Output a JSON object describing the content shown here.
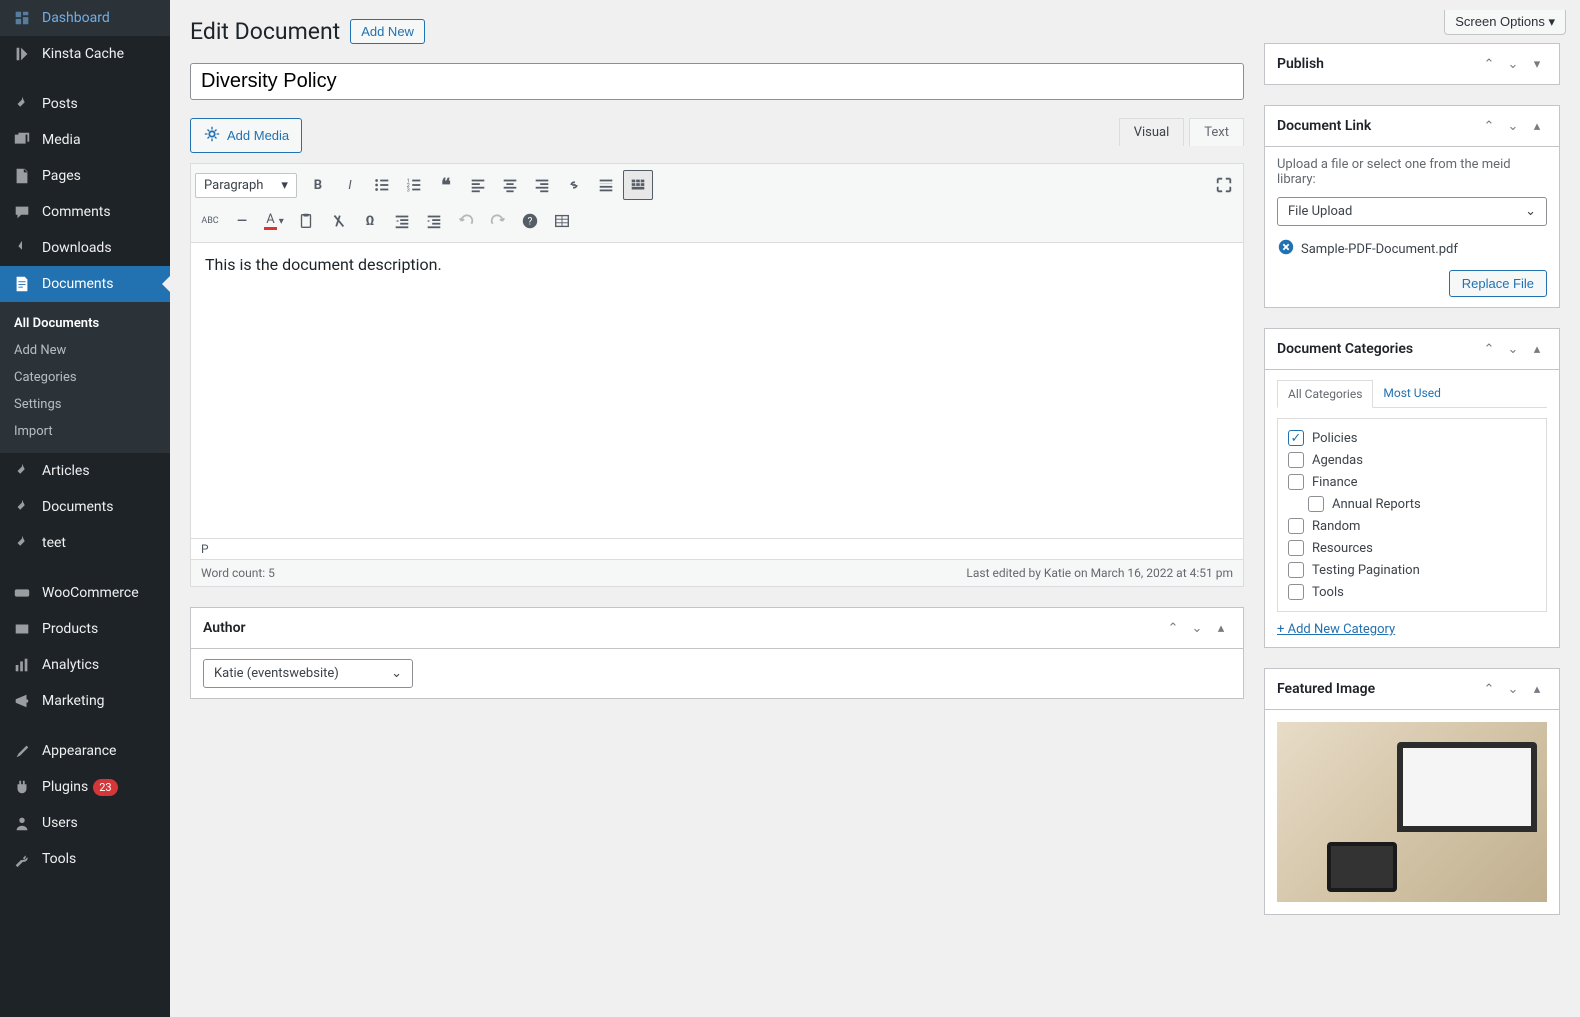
{
  "sidebar": {
    "items": [
      {
        "icon": "dashboard",
        "label": "Dashboard"
      },
      {
        "icon": "kinsta",
        "label": "Kinsta Cache"
      },
      {
        "icon": "pin",
        "label": "Posts"
      },
      {
        "icon": "media",
        "label": "Media"
      },
      {
        "icon": "page",
        "label": "Pages"
      },
      {
        "icon": "comment",
        "label": "Comments"
      },
      {
        "icon": "download",
        "label": "Downloads"
      },
      {
        "icon": "document",
        "label": "Documents",
        "active": true
      },
      {
        "icon": "pin",
        "label": "Articles"
      },
      {
        "icon": "pin",
        "label": "Documents"
      },
      {
        "icon": "pin",
        "label": "teet"
      },
      {
        "icon": "woo",
        "label": "WooCommerce"
      },
      {
        "icon": "product",
        "label": "Products"
      },
      {
        "icon": "analytics",
        "label": "Analytics"
      },
      {
        "icon": "marketing",
        "label": "Marketing"
      },
      {
        "icon": "appearance",
        "label": "Appearance"
      },
      {
        "icon": "plugin",
        "label": "Plugins",
        "badge": "23"
      },
      {
        "icon": "user",
        "label": "Users"
      },
      {
        "icon": "tools",
        "label": "Tools"
      }
    ],
    "submenu": [
      {
        "label": "All Documents",
        "current": true
      },
      {
        "label": "Add New"
      },
      {
        "label": "Categories"
      },
      {
        "label": "Settings"
      },
      {
        "label": "Import"
      }
    ]
  },
  "screenOptions": "Screen Options",
  "header": {
    "title": "Edit Document",
    "addNew": "Add New"
  },
  "titleInput": "Diversity Policy",
  "addMedia": "Add Media",
  "editorTabs": {
    "visual": "Visual",
    "text": "Text"
  },
  "formatSelect": "Paragraph",
  "editorContent": "This is the document description.",
  "editorPath": "P",
  "wordCount": "Word count: 5",
  "lastEdited": "Last edited by Katie on March 16, 2022 at 4:51 pm",
  "authorBox": {
    "title": "Author",
    "value": "Katie (eventswebsite)"
  },
  "publishBox": {
    "title": "Publish"
  },
  "docLinkBox": {
    "title": "Document Link",
    "help": "Upload a file or select one from the meid library:",
    "select": "File Upload",
    "file": "Sample-PDF-Document.pdf",
    "replace": "Replace File"
  },
  "catBox": {
    "title": "Document Categories",
    "tabAll": "All Categories",
    "tabMost": "Most Used",
    "items": [
      {
        "label": "Policies",
        "checked": true
      },
      {
        "label": "Agendas"
      },
      {
        "label": "Finance"
      },
      {
        "label": "Annual Reports",
        "indent": true
      },
      {
        "label": "Random"
      },
      {
        "label": "Resources"
      },
      {
        "label": "Testing Pagination"
      },
      {
        "label": "Tools"
      }
    ],
    "addNew": "+ Add New Category"
  },
  "featuredBox": {
    "title": "Featured Image"
  }
}
